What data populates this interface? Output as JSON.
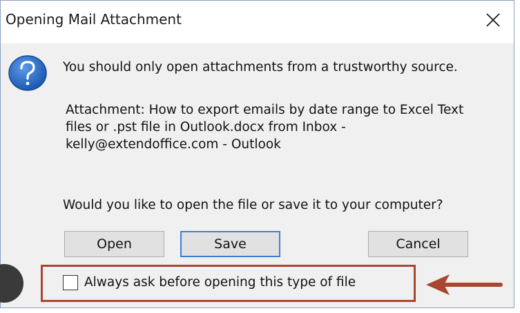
{
  "dialog": {
    "title": "Opening Mail Attachment",
    "close_icon": "close-icon",
    "message_icon": "question-icon",
    "message": "You should only open attachments from a trustworthy source.",
    "attachment_lines": [
      "Attachment: How to export emails by date range to Excel Text",
      "files or .pst file in Outlook.docx from Inbox -",
      "kelly@extendoffice.com - Outlook"
    ],
    "question": "Would you like to open the file or save it to your computer?",
    "buttons": {
      "open": "Open",
      "save": "Save",
      "cancel": "Cancel"
    },
    "checkbox": {
      "label": "Always ask before opening this type of file",
      "checked": false
    }
  },
  "annotation": {
    "highlight_color": "#a84630",
    "arrow_icon": "left-arrow-icon"
  },
  "colors": {
    "accent": "#3c7fd6",
    "icon_blue": "#1e5fb8",
    "dialog_bg": "#f0f0f0"
  }
}
